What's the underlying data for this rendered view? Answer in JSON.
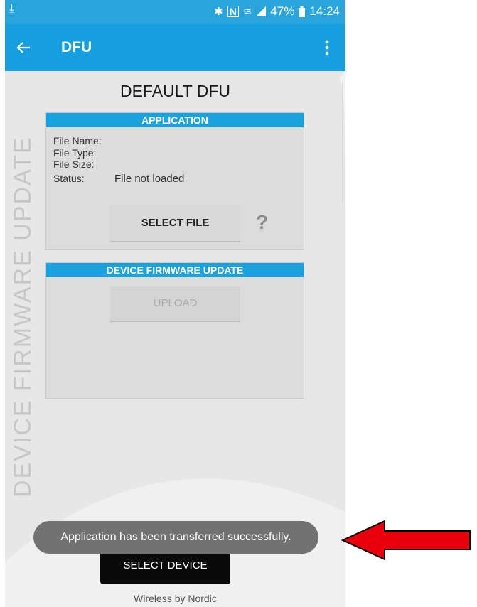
{
  "status_bar": {
    "download_icon": "download-arrow-icon",
    "icons": [
      "bluetooth-icon",
      "nfc-icon",
      "wifi-icon",
      "signal-icon"
    ],
    "battery": "47%",
    "time": "14:24"
  },
  "app_bar": {
    "back_icon": "arrow-left-icon",
    "title": "DFU",
    "menu_icon": "overflow-menu-icon"
  },
  "page": {
    "title": "DEFAULT DFU",
    "side_label": "DEVICE FIRMWARE UPDATE"
  },
  "application_panel": {
    "header": "APPLICATION",
    "fields": [
      {
        "label": "File Name:",
        "value": ""
      },
      {
        "label": "File Type:",
        "value": ""
      },
      {
        "label": "File Size:",
        "value": ""
      },
      {
        "label": "Status:",
        "value": "File not loaded"
      }
    ],
    "select_file": "SELECT FILE",
    "help": "?"
  },
  "dfu_panel": {
    "header": "DEVICE FIRMWARE UPDATE",
    "upload": "UPLOAD"
  },
  "toast": "Application has been transferred successfully.",
  "select_device": "SELECT DEVICE",
  "footer": "Wireless by Nordic",
  "colors": {
    "accent": "#159ee0",
    "annotation_arrow": "#e8000b"
  }
}
